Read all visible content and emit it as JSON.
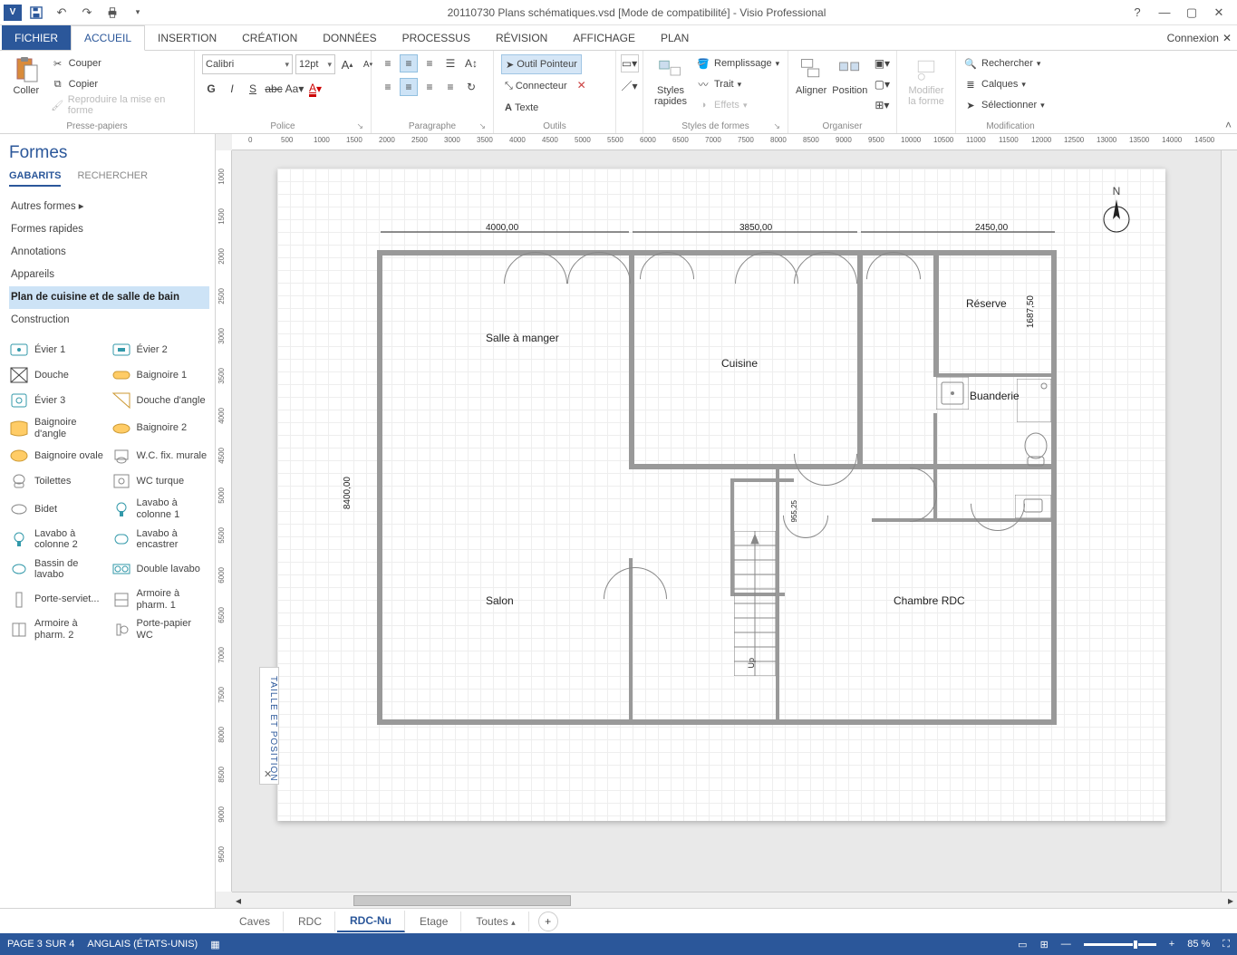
{
  "title": "20110730 Plans schématiques.vsd  [Mode de compatibilité] - Visio Professional",
  "menubar": {
    "fichier": "FICHIER",
    "tabs": [
      "ACCUEIL",
      "INSERTION",
      "CRÉATION",
      "DONNÉES",
      "PROCESSUS",
      "RÉVISION",
      "AFFICHAGE",
      "PLAN"
    ],
    "connexion": "Connexion"
  },
  "ribbon": {
    "clipboard": {
      "paste": "Coller",
      "cut": "Couper",
      "copy": "Copier",
      "formatpainter": "Reproduire la mise en forme",
      "label": "Presse-papiers"
    },
    "font": {
      "name": "Calibri",
      "size": "12pt",
      "label": "Police"
    },
    "paragraph": {
      "label": "Paragraphe"
    },
    "tools": {
      "pointer": "Outil Pointeur",
      "connector": "Connecteur",
      "text": "Texte",
      "label": "Outils"
    },
    "styles": {
      "quick": "Styles rapides",
      "fill": "Remplissage",
      "line": "Trait",
      "effects": "Effets",
      "label": "Styles de formes"
    },
    "arrange": {
      "align": "Aligner",
      "position": "Position",
      "label": "Organiser"
    },
    "edit": {
      "modifyshape": "Modifier la forme",
      "find": "Rechercher",
      "layers": "Calques",
      "select": "Sélectionner",
      "label": "Modification"
    }
  },
  "shapes": {
    "title": "Formes",
    "tabs": {
      "gabarits": "GABARITS",
      "rechercher": "RECHERCHER"
    },
    "categories": [
      "Autres formes",
      "Formes rapides",
      "Annotations",
      "Appareils",
      "Plan de cuisine et de salle de bain",
      "Construction"
    ],
    "selectedCategory": "Plan de cuisine et de salle de bain",
    "items": [
      {
        "label": "Évier 1"
      },
      {
        "label": "Évier 2"
      },
      {
        "label": "Douche"
      },
      {
        "label": "Baignoire 1"
      },
      {
        "label": "Évier 3"
      },
      {
        "label": "Douche d'angle"
      },
      {
        "label": "Baignoire d'angle"
      },
      {
        "label": "Baignoire 2"
      },
      {
        "label": "Baignoire ovale"
      },
      {
        "label": "W.C. fix. murale"
      },
      {
        "label": "Toilettes"
      },
      {
        "label": "WC turque"
      },
      {
        "label": "Bidet"
      },
      {
        "label": "Lavabo à colonne 1"
      },
      {
        "label": "Lavabo à colonne 2"
      },
      {
        "label": "Lavabo à encastrer"
      },
      {
        "label": "Bassin de lavabo"
      },
      {
        "label": "Double lavabo"
      },
      {
        "label": "Porte-serviet..."
      },
      {
        "label": "Armoire à pharm. 1"
      },
      {
        "label": "Armoire à pharm. 2"
      },
      {
        "label": "Porte-papier WC"
      }
    ]
  },
  "pageTabs": {
    "tabs": [
      "Caves",
      "RDC",
      "RDC-Nu",
      "Etage",
      "Toutes"
    ],
    "active": "RDC-Nu"
  },
  "floorplan": {
    "rooms": {
      "salle": "Salle à manger",
      "cuisine": "Cuisine",
      "reserve": "Réserve",
      "buanderie": "Buanderie",
      "salon": "Salon",
      "chambre": "Chambre RDC"
    },
    "dims": {
      "w1": "4000,00",
      "w2": "3850,00",
      "w3": "2450,00",
      "h": "8400,00",
      "hr": "1687,50",
      "stair": "955,25",
      "up": "Up"
    },
    "compass": "N"
  },
  "sidetab": "TAILLE ET POSITION",
  "status": {
    "page": "PAGE 3 SUR 4",
    "lang": "ANGLAIS (ÉTATS-UNIS)",
    "zoom": "85 %"
  },
  "ruler": {
    "h": [
      "0",
      "500",
      "1000",
      "1500",
      "2000",
      "2500",
      "3000",
      "3500",
      "4000",
      "4500",
      "5000",
      "5500",
      "6000",
      "6500",
      "7000",
      "7500",
      "8000",
      "8500",
      "9000",
      "9500",
      "10000",
      "10500",
      "11000",
      "11500",
      "12000",
      "12500",
      "13000",
      "13500",
      "14000",
      "14500"
    ],
    "v": [
      "1000",
      "1500",
      "2000",
      "2500",
      "3000",
      "3500",
      "4000",
      "4500",
      "5000",
      "5500",
      "6000",
      "6500",
      "7000",
      "7500",
      "8000",
      "8500",
      "9000",
      "9500"
    ]
  }
}
